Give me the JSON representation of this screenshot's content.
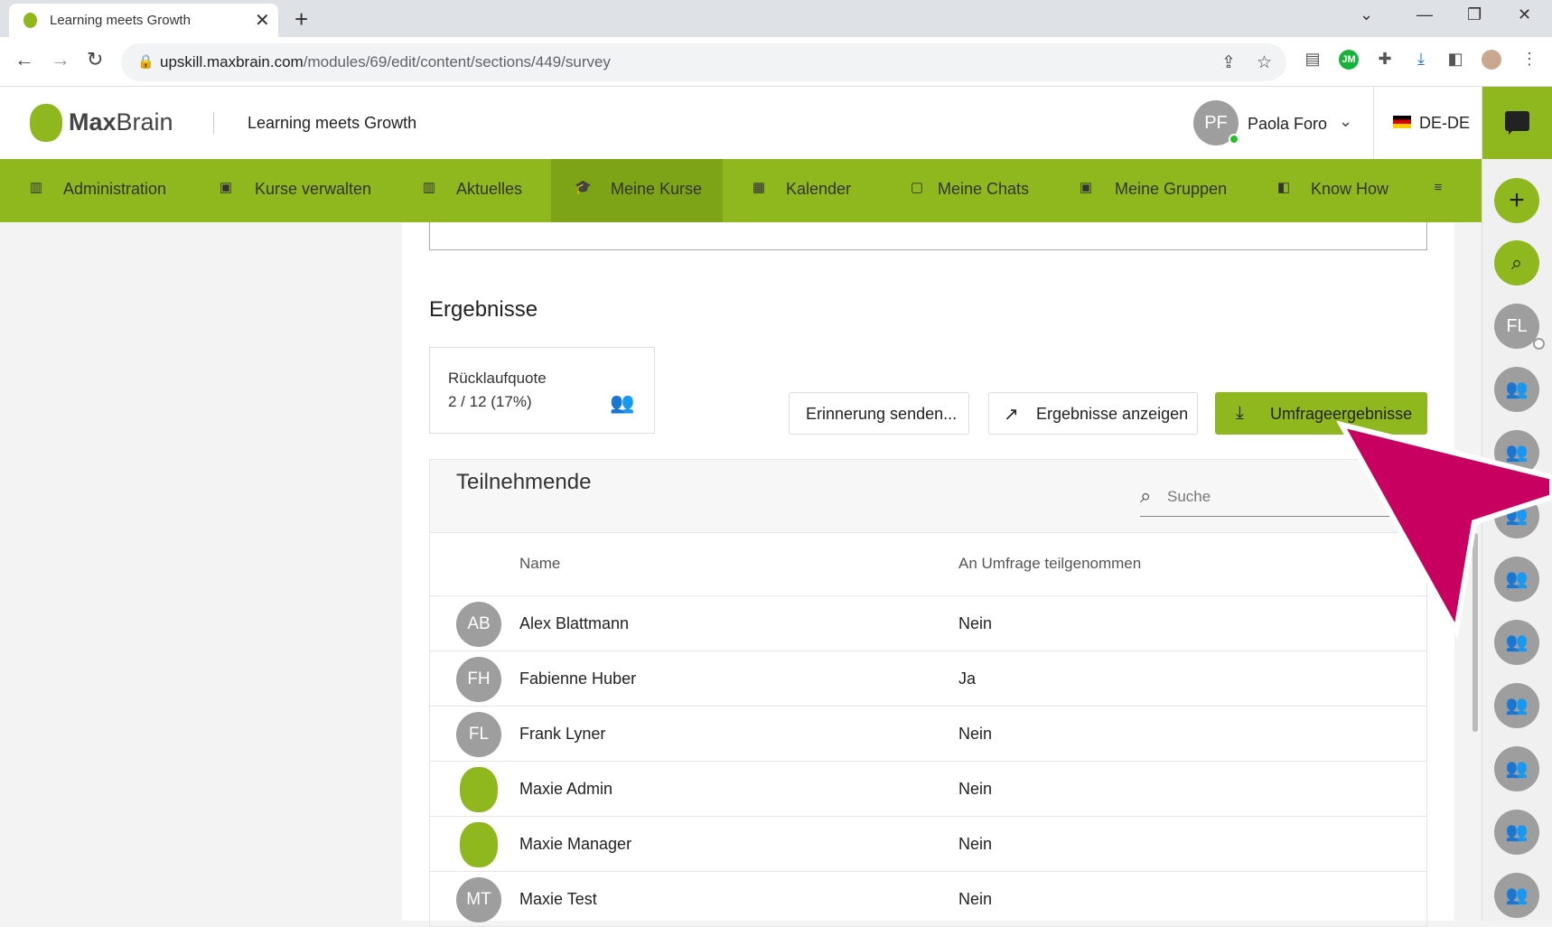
{
  "browser": {
    "tab_title": "Learning meets Growth",
    "url_domain": "upskill.maxbrain.com",
    "url_path": "/modules/69/edit/content/sections/449/survey"
  },
  "header": {
    "logo_bold": "Max",
    "logo_light": "Brain",
    "title": "Learning meets Growth",
    "user_initials": "PF",
    "user_name": "Paola Foro",
    "language": "DE-DE"
  },
  "nav": {
    "items": [
      {
        "label": "Administration",
        "icon": "library-icon"
      },
      {
        "label": "Kurse verwalten",
        "icon": "id-card-icon"
      },
      {
        "label": "Aktuelles",
        "icon": "library-icon"
      },
      {
        "label": "Meine Kurse",
        "icon": "graduation-cap-icon",
        "active": true
      },
      {
        "label": "Kalender",
        "icon": "calendar-icon"
      },
      {
        "label": "Meine Chats",
        "icon": "chat-icon"
      },
      {
        "label": "Meine Gruppen",
        "icon": "id-card-icon"
      },
      {
        "label": "Know How",
        "icon": "book-icon"
      }
    ]
  },
  "rail": {
    "contact_initials": "FL"
  },
  "results": {
    "title": "Ergebnisse",
    "response_label": "Rücklaufquote",
    "response_value": "2 / 12 (17%)",
    "remind_button": "Erinnerung senden...",
    "show_button": "Ergebnisse anzeigen",
    "download_button": "Umfrageergebnisse"
  },
  "participants": {
    "title": "Teilnehmende",
    "search_placeholder": "Suche",
    "col_name": "Name",
    "col_status": "An Umfrage teilgenommen",
    "rows": [
      {
        "initials": "AB",
        "name": "Alex Blattmann",
        "status": "Nein"
      },
      {
        "initials": "FH",
        "name": "Fabienne Huber",
        "status": "Ja"
      },
      {
        "initials": "FL",
        "name": "Frank Lyner",
        "status": "Nein"
      },
      {
        "initials": "",
        "name": "Maxie Admin",
        "status": "Nein"
      },
      {
        "initials": "",
        "name": "Maxie Manager",
        "status": "Nein"
      },
      {
        "initials": "MT",
        "name": "Maxie Test",
        "status": "Nein"
      }
    ]
  },
  "colors": {
    "brand_green": "#8fb81e",
    "active_green": "#7da416",
    "annotation_arrow": "#c8005f"
  }
}
